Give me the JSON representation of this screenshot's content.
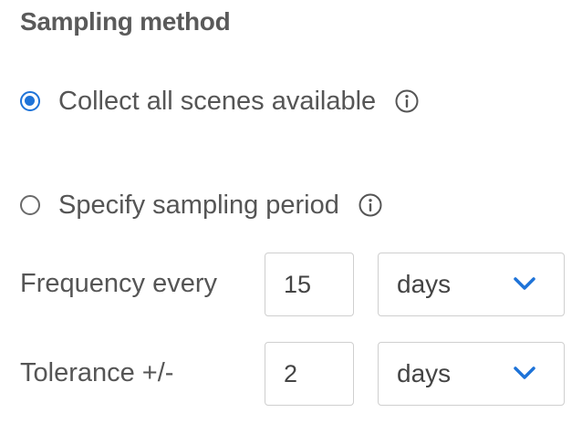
{
  "section": {
    "title": "Sampling method"
  },
  "options": [
    {
      "label": "Collect all scenes available",
      "checked": true,
      "info_icon": "info-icon"
    },
    {
      "label": "Specify sampling period",
      "checked": false,
      "info_icon": "info-icon"
    }
  ],
  "frequency": {
    "label": "Frequency every",
    "value": "15",
    "unit": "days",
    "unit_icon": "chevron-down-icon"
  },
  "tolerance": {
    "label": "Tolerance +/-",
    "value": "2",
    "unit": "days",
    "unit_icon": "chevron-down-icon"
  },
  "colors": {
    "accent": "#1e73d8",
    "text": "#555555",
    "border": "#cfcfcf"
  }
}
